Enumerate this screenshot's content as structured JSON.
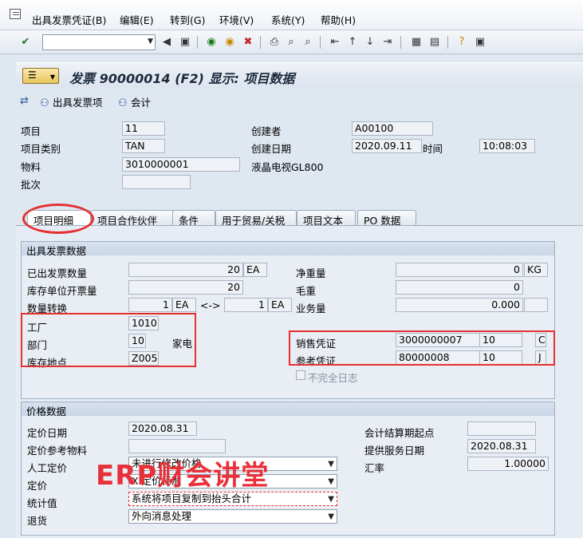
{
  "menu": {
    "items": [
      "出具发票凭证(B)",
      "编辑(E)",
      "转到(G)",
      "环境(V)",
      "系统(Y)",
      "帮助(H)"
    ]
  },
  "toolbar": {
    "command_field_value": ""
  },
  "title": {
    "text": "发票 90000014   (F2) 显示: 项目数据"
  },
  "app_toolbar": {
    "issue_invoice_item": "出具发票项",
    "accounting": "会计"
  },
  "header": {
    "item_label": "项目",
    "item_value": "11",
    "item_category_label": "项目类别",
    "item_category_value": "TAN",
    "material_label": "物料",
    "material_value": "3010000001",
    "material_desc": "液晶电视GL800",
    "batch_label": "批次",
    "batch_value": "",
    "creator_label": "创建者",
    "creator_value": "A00100",
    "created_date_label": "创建日期",
    "created_date_value": "2020.09.11",
    "time_label": "时间",
    "time_value": "10:08:03"
  },
  "tabs": [
    "项目明细",
    "项目合作伙伴",
    "条件",
    "用于贸易/关税",
    "项目文本",
    "PO 数据"
  ],
  "invoice_group": {
    "title": "出具发票数据",
    "billed_qty_label": "已出发票数量",
    "billed_qty_value": "20",
    "billed_qty_unit": "EA",
    "stock_qty_label": "库存单位开票量",
    "stock_qty_value": "20",
    "conversion_label": "数量转换",
    "conv_left": "1",
    "conv_left_unit": "EA",
    "conv_arrow": "<->",
    "conv_right": "1",
    "conv_right_unit": "EA",
    "plant_label": "工厂",
    "plant_value": "1010",
    "division_label": "部门",
    "division_value": "10",
    "division_desc": "家电",
    "storage_label": "库存地点",
    "storage_value": "Z005",
    "net_weight_label": "净重量",
    "net_weight_value": "0",
    "net_weight_unit": "KG",
    "gross_weight_label": "毛重",
    "gross_weight_value": "0",
    "volume_label": "业务量",
    "volume_value": "0.000",
    "volume_unit": "",
    "sales_doc_label": "销售凭证",
    "sales_doc_value": "3000000007",
    "sales_doc_item": "10",
    "sales_doc_cat": "C",
    "ref_doc_label": "参考凭证",
    "ref_doc_value": "80000008",
    "ref_doc_item": "10",
    "ref_doc_cat": "J",
    "incomplete_label": "不完全日志"
  },
  "pricing_group": {
    "title": "价格数据",
    "pricing_date_label": "定价日期",
    "pricing_date_value": "2020.08.31",
    "pricing_ref_label": "定价参考物料",
    "pricing_ref_value": "",
    "manual_label": "人工定价",
    "manual_value": "未进行修改价格",
    "pricing_label": "定价",
    "pricing_value": "X 定价标准",
    "statistical_label": "统计值",
    "statistical_value": "系统将项目复制到抬头合计",
    "returns_label": "退货",
    "returns_value": "外向消息处理",
    "settle_start_label": "会计结算期起点",
    "settle_start_value": "",
    "service_date_label": "提供服务日期",
    "service_date_value": "2020.08.31",
    "exchange_label": "汇率",
    "exchange_value": "1.00000"
  },
  "watermark": "ERP财会讲堂",
  "colors": {
    "highlight": "#e53030",
    "watermark": "#e8303a"
  }
}
